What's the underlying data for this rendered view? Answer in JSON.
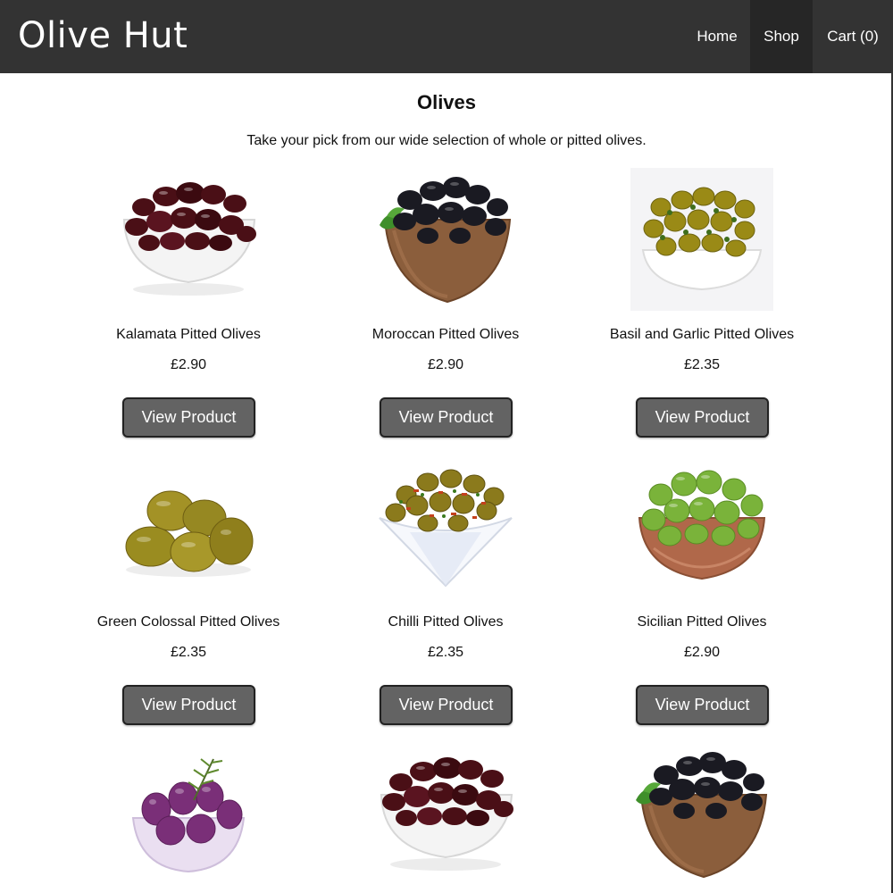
{
  "header": {
    "brand": "Olive Hut",
    "nav": {
      "home": "Home",
      "shop": "Shop",
      "cart": "Cart (0)"
    }
  },
  "main": {
    "title": "Olives",
    "intro": "Take your pick from our wide selection of whole or pitted olives.",
    "button_label": "View Product",
    "products": [
      {
        "name": "Kalamata Pitted Olives",
        "price": "£2.90",
        "image": "kalamata-olives-bowl"
      },
      {
        "name": "Moroccan Pitted Olives",
        "price": "£2.90",
        "image": "black-olives-wooden-bowl"
      },
      {
        "name": "Basil and Garlic Pitted Olives",
        "price": "£2.35",
        "image": "green-olives-white-bowl"
      },
      {
        "name": "Green Colossal Pitted Olives",
        "price": "£2.35",
        "image": "green-colossal-olives"
      },
      {
        "name": "Chilli Pitted Olives",
        "price": "£2.35",
        "image": "chilli-olives-square-bowl"
      },
      {
        "name": "Sicilian Pitted Olives",
        "price": "£2.90",
        "image": "green-olives-copper-bowl"
      },
      {
        "image": "purple-olives-glass-bowl"
      },
      {
        "image": "kalamata-olives-bowl"
      },
      {
        "image": "black-olives-wooden-bowl"
      }
    ]
  }
}
